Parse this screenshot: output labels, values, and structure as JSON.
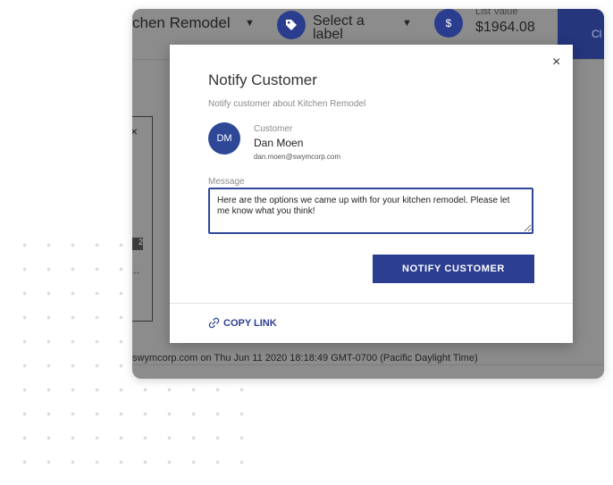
{
  "header": {
    "project_title": "chen Remodel",
    "label_select": "Select a label",
    "list_value_caption": "List Value",
    "list_value": "$1964.08",
    "dollar_icon_glyph": "$",
    "header_button_fragment": "Cl"
  },
  "background": {
    "badge_text": "2",
    "ellipsis": "...",
    "card_close": "×",
    "activity_line": "swymcorp.com on Thu Jun 11 2020 18:18:49 GMT-0700 (Pacific Daylight Time)"
  },
  "modal": {
    "close_glyph": "×",
    "title": "Notify Customer",
    "subtitle": "Notify customer about Kitchen Remodel",
    "customer": {
      "caption": "Customer",
      "initials": "DM",
      "name": "Dan Moen",
      "email": "dan.moen@swymcorp.com"
    },
    "message_label": "Message",
    "message_value": "Here are the options we came up with for your kitchen remodel. Please let me know what you think!",
    "notify_button_label": "NOTIFY CUSTOMER",
    "copy_link_label": "COPY LINK"
  },
  "colors": {
    "brand_blue": "#2b3e91",
    "overlay_gray": "#8c8c8c"
  },
  "icons": {
    "tag": "tag-icon",
    "dollar": "dollar-icon",
    "link": "link-icon",
    "close": "close-icon",
    "dropdown": "caret-down-icon"
  }
}
